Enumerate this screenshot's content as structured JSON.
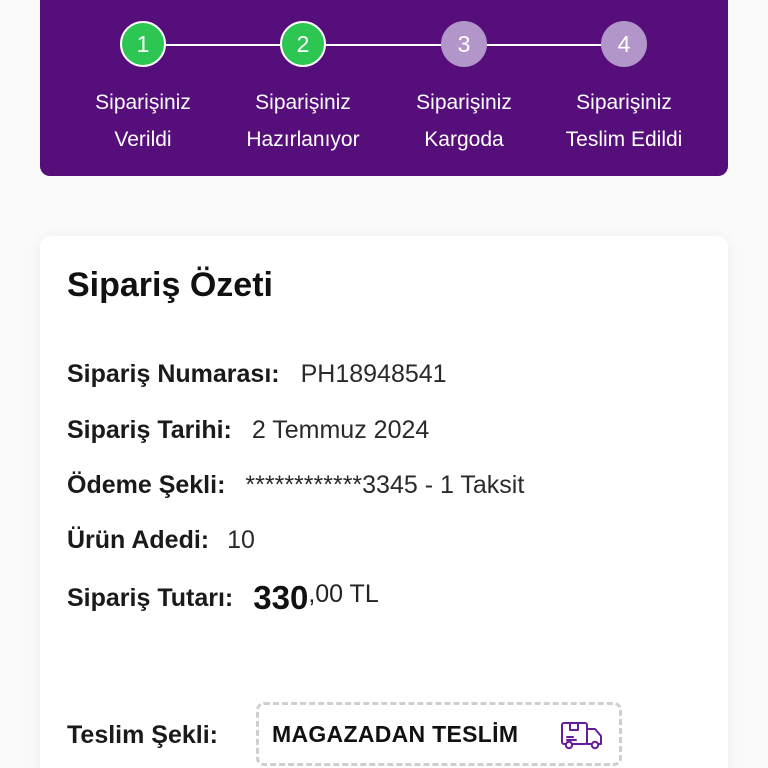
{
  "steps": [
    {
      "number": "1",
      "label_line1": "Siparişiniz",
      "label_line2": "Verildi",
      "state": "done"
    },
    {
      "number": "2",
      "label_line1": "Siparişiniz",
      "label_line2": "Hazırlanıyor",
      "state": "done"
    },
    {
      "number": "3",
      "label_line1": "Siparişiniz",
      "label_line2": "Kargoda",
      "state": "todo"
    },
    {
      "number": "4",
      "label_line1": "Siparişiniz",
      "label_line2": "Teslim Edildi",
      "state": "todo"
    }
  ],
  "summary": {
    "title": "Sipariş Özeti",
    "order_number_label": "Sipariş Numarası:",
    "order_number": "PH18948541",
    "order_date_label": "Sipariş Tarihi:",
    "order_date": "2 Temmuz 2024",
    "payment_label": "Ödeme Şekli:",
    "payment_value": "************3345 - 1 Taksit",
    "quantity_label": "Ürün Adedi:",
    "quantity": "10",
    "total_label": "Sipariş Tutarı:",
    "total_int": "330",
    "total_dec": ",00 TL",
    "delivery_label": "Teslim Şekli:",
    "delivery_value": "MAGAZADAN TESLİM"
  },
  "colors": {
    "panel": "#560e7a",
    "step_done": "#2dc653",
    "step_todo": "#b396c9",
    "icon_accent": "#6a1b9a"
  },
  "icons": {
    "delivery": "truck-icon"
  }
}
